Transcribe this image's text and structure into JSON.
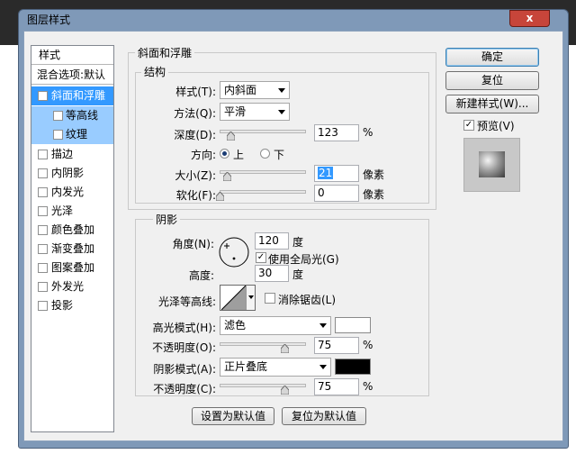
{
  "window": {
    "title": "图层样式",
    "close_glyph": "x"
  },
  "left_panel": {
    "header": "样式",
    "blending": "混合选项:默认",
    "items": [
      {
        "label": "斜面和浮雕",
        "checked": true
      },
      {
        "label": "等高线",
        "checked": false
      },
      {
        "label": "纹理",
        "checked": false
      },
      {
        "label": "描边",
        "checked": false
      },
      {
        "label": "内阴影",
        "checked": false
      },
      {
        "label": "内发光",
        "checked": false
      },
      {
        "label": "光泽",
        "checked": false
      },
      {
        "label": "颜色叠加",
        "checked": false
      },
      {
        "label": "渐变叠加",
        "checked": false
      },
      {
        "label": "图案叠加",
        "checked": false
      },
      {
        "label": "外发光",
        "checked": false
      },
      {
        "label": "投影",
        "checked": false
      }
    ]
  },
  "bevel": {
    "group_title": "斜面和浮雕",
    "structure_title": "结构",
    "style_label": "样式(T):",
    "style_value": "内斜面",
    "technique_label": "方法(Q):",
    "technique_value": "平滑",
    "depth_label": "深度(D):",
    "depth_value": "123",
    "depth_unit": "%",
    "depth_level": 0.123,
    "direction_label": "方向:",
    "dir_up": "上",
    "dir_down": "下",
    "direction_selected": "上",
    "size_label": "大小(Z):",
    "size_value": "21",
    "size_unit": "像素",
    "size_level": 0.085,
    "soften_label": "软化(F):",
    "soften_value": "0",
    "soften_unit": "像素",
    "soften_level": 0
  },
  "shading": {
    "title": "阴影",
    "angle_label": "角度(N):",
    "angle_value": "120",
    "angle_unit": "度",
    "global_light_label": "使用全局光(G)",
    "global_light_checked": true,
    "altitude_label": "高度:",
    "altitude_value": "30",
    "altitude_unit": "度",
    "gloss_label": "光泽等高线:",
    "antialias_label": "消除锯齿(L)",
    "antialias_checked": false,
    "highlight_mode_label": "高光模式(H):",
    "highlight_mode_value": "滤色",
    "highlight_color": "#ffffff",
    "highlight_opacity_label": "不透明度(O):",
    "highlight_opacity_value": "75",
    "highlight_opacity_unit": "%",
    "highlight_opacity_level": 0.75,
    "shadow_mode_label": "阴影模式(A):",
    "shadow_mode_value": "正片叠底",
    "shadow_color": "#000000",
    "shadow_opacity_label": "不透明度(C):",
    "shadow_opacity_value": "75",
    "shadow_opacity_unit": "%",
    "shadow_opacity_level": 0.75
  },
  "bottom_buttons": {
    "make_default": "设置为默认值",
    "reset_default": "复位为默认值"
  },
  "right_buttons": {
    "ok": "确定",
    "reset": "复位",
    "new_style": "新建样式(W)...",
    "preview_label": "预览(V)",
    "preview_checked": true
  }
}
